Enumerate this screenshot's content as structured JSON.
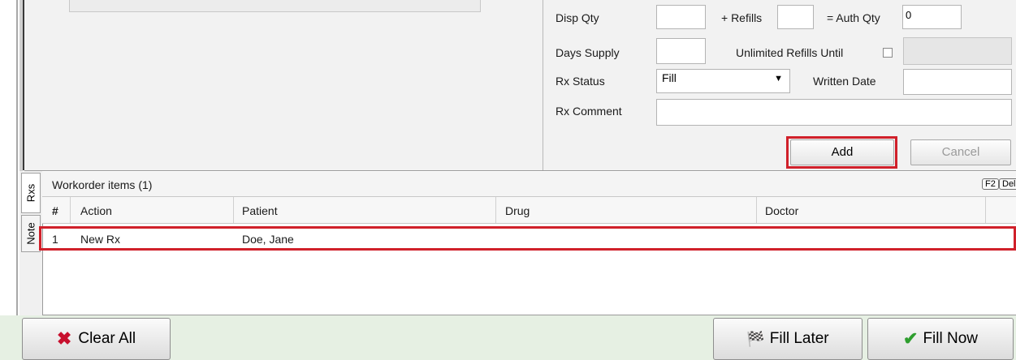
{
  "form": {
    "disp_qty_label": "Disp Qty",
    "disp_qty_value": "",
    "refills_label": "+ Refills",
    "refills_value": "",
    "auth_qty_label": "= Auth Qty",
    "auth_qty_value": "0",
    "days_supply_label": "Days Supply",
    "days_supply_value": "",
    "unlimited_refills_label": "Unlimited Refills Until",
    "unlimited_refills_checked": false,
    "rx_status_label": "Rx Status",
    "rx_status_value": "Fill",
    "written_date_label": "Written Date",
    "written_date_value": "",
    "rx_comment_label": "Rx Comment",
    "rx_comment_value": "",
    "add_label": "Add",
    "cancel_label": "Cancel"
  },
  "tabs": [
    "Rxs",
    "Note"
  ],
  "workorder": {
    "title": "Workorder items (1)",
    "shortcut_f2": "F2",
    "shortcut_del": "Del",
    "columns": [
      "#",
      "Action",
      "Patient",
      "Drug",
      "Doctor"
    ],
    "rows": [
      {
        "num": "1",
        "action": "New Rx",
        "patient": "Doe, Jane",
        "drug": "",
        "doctor": ""
      }
    ]
  },
  "toolbar": {
    "clear_all_label": "Clear All",
    "fill_later_label": "Fill Later",
    "fill_now_label": "Fill Now"
  },
  "colors": {
    "highlight": "#d0202a",
    "clear_icon": "#c8102e",
    "check_icon": "#2e9e2e",
    "toolbar_bg": "#e6f0e3"
  }
}
